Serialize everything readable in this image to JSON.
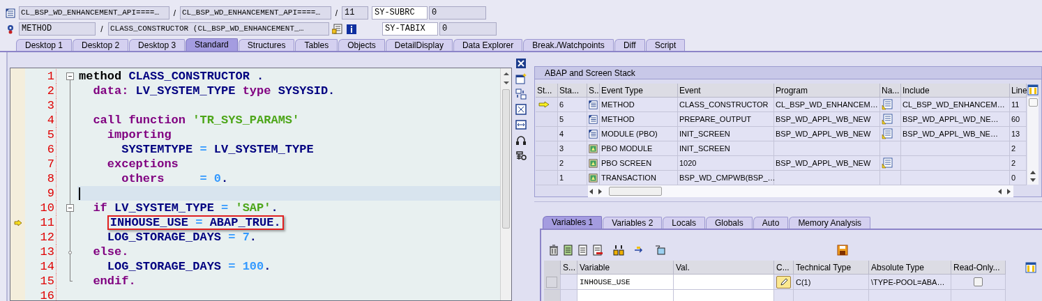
{
  "header": {
    "row_1": {
      "class_field": "CL_BSP_WD_ENHANCEMENT_API====…",
      "separator_1": "/",
      "include_field": "CL_BSP_WD_ENHANCEMENT_API====…",
      "separator_2": "/",
      "line_field": "11",
      "sysvar_label": "SY-SUBRC",
      "sysvar_value": "0"
    },
    "row_2": {
      "type_field": "METHOD",
      "separator": "/",
      "event_field": "CLASS_CONSTRUCTOR (CL_BSP_WD_ENHANCEMENT_…",
      "sysvar_label": "SY-TABIX",
      "sysvar_value": "0"
    }
  },
  "tabs": [
    {
      "label": "Desktop 1",
      "selected": false
    },
    {
      "label": "Desktop 2",
      "selected": false
    },
    {
      "label": "Desktop 3",
      "selected": false
    },
    {
      "label": "Standard",
      "selected": true
    },
    {
      "label": "Structures",
      "selected": false
    },
    {
      "label": "Tables",
      "selected": false
    },
    {
      "label": "Objects",
      "selected": false
    },
    {
      "label": "DetailDisplay",
      "selected": false
    },
    {
      "label": "Data Explorer",
      "selected": false
    },
    {
      "label": "Break./Watchpoints",
      "selected": false
    },
    {
      "label": "Diff",
      "selected": false
    },
    {
      "label": "Script",
      "selected": false
    }
  ],
  "editor": {
    "lines": [
      {
        "number": "1",
        "fold_start": true,
        "segments": [
          {
            "kind": "statement",
            "text": "method"
          },
          {
            "kind": "identifier",
            "text": " CLASS_CONSTRUCTOR ."
          }
        ]
      },
      {
        "number": "2",
        "segments": [
          {
            "kind": "keyword",
            "text": "  data:"
          },
          {
            "kind": "identifier",
            "text": " LV_SYSTEM_TYPE "
          },
          {
            "kind": "keyword",
            "text": "type"
          },
          {
            "kind": "identifier",
            "text": " SYSYSID."
          }
        ]
      },
      {
        "number": "3"
      },
      {
        "number": "4",
        "segments": [
          {
            "kind": "keyword",
            "text": "  call function"
          },
          {
            "kind": "string",
            "text": " 'TR_SYS_PARAMS'"
          }
        ]
      },
      {
        "number": "5",
        "segments": [
          {
            "kind": "keyword",
            "text": "    importing"
          }
        ]
      },
      {
        "number": "6",
        "segments": [
          {
            "kind": "identifier",
            "text": "      SYSTEMTYPE"
          },
          {
            "kind": "operator",
            "text": " = "
          },
          {
            "kind": "identifier",
            "text": "LV_SYSTEM_TYPE"
          }
        ]
      },
      {
        "number": "7",
        "segments": [
          {
            "kind": "keyword",
            "text": "    exceptions"
          }
        ]
      },
      {
        "number": "8",
        "segments": [
          {
            "kind": "keyword",
            "text": "      others"
          },
          {
            "kind": "operator",
            "text": "     = "
          },
          {
            "kind": "number",
            "text": "0"
          },
          {
            "kind": "identifier",
            "text": "."
          }
        ]
      },
      {
        "number": "9",
        "cursor": true
      },
      {
        "number": "10",
        "fold_start": true,
        "segments": [
          {
            "kind": "keyword",
            "text": "  if"
          },
          {
            "kind": "identifier",
            "text": " LV_SYSTEM_TYPE "
          },
          {
            "kind": "operator",
            "text": "= "
          },
          {
            "kind": "string",
            "text": "'SAP'"
          },
          {
            "kind": "identifier",
            "text": "."
          }
        ]
      },
      {
        "number": "11",
        "execution_point": true,
        "boxed": true,
        "segments": [
          {
            "kind": "identifier",
            "text": "    INHOUSE_USE"
          },
          {
            "kind": "operator",
            "text": " = "
          },
          {
            "kind": "identifier",
            "text": "ABAP_TRUE."
          }
        ]
      },
      {
        "number": "12",
        "segments": [
          {
            "kind": "identifier",
            "text": "    LOG_STORAGE_DAYS"
          },
          {
            "kind": "operator",
            "text": " = "
          },
          {
            "kind": "number",
            "text": "7"
          },
          {
            "kind": "identifier",
            "text": "."
          }
        ]
      },
      {
        "number": "13",
        "fold_branch": true,
        "segments": [
          {
            "kind": "keyword",
            "text": "  else."
          }
        ]
      },
      {
        "number": "14",
        "segments": [
          {
            "kind": "identifier",
            "text": "    LOG_STORAGE_DAYS"
          },
          {
            "kind": "operator",
            "text": " = "
          },
          {
            "kind": "number",
            "text": "100"
          },
          {
            "kind": "identifier",
            "text": "."
          }
        ]
      },
      {
        "number": "15",
        "fold_end": true,
        "segments": [
          {
            "kind": "keyword",
            "text": "  endif."
          }
        ]
      },
      {
        "number": "16"
      }
    ]
  },
  "stack": {
    "title": "ABAP and Screen Stack",
    "columns": [
      "St...",
      "Sta...",
      "S..",
      "Event Type",
      "Event",
      "Program",
      "Na...",
      "Include",
      "Line"
    ],
    "rows": [
      {
        "current": true,
        "stack_no": "6",
        "kind": "method",
        "event_type": "METHOD",
        "event": "CLASS_CONSTRUCTOR",
        "program": "CL_BSP_WD_ENHANCEM…",
        "navigable": true,
        "include": "CL_BSP_WD_ENHANCEM…",
        "line": "11"
      },
      {
        "current": false,
        "stack_no": "5",
        "kind": "method",
        "event_type": "METHOD",
        "event": "PREPARE_OUTPUT",
        "program": "BSP_WD_APPL_WB_NEW",
        "navigable": true,
        "include": "BSP_WD_APPL_WD_NE…",
        "line": "60"
      },
      {
        "current": false,
        "stack_no": "4",
        "kind": "method",
        "event_type": "MODULE (PBO)",
        "event": "INIT_SCREEN",
        "program": "BSP_WD_APPL_WB_NEW",
        "navigable": true,
        "include": "BSP_WD_APPL_WB_NE…",
        "line": "13"
      },
      {
        "current": false,
        "stack_no": "3",
        "kind": "screen",
        "event_type": "PBO MODULE",
        "event": "INIT_SCREEN",
        "navigable": false,
        "line": "2"
      },
      {
        "current": false,
        "stack_no": "2",
        "kind": "screen",
        "event_type": "PBO SCREEN",
        "event": "1020",
        "program": "BSP_WD_APPL_WB_NEW",
        "navigable": true,
        "line": "2"
      },
      {
        "current": false,
        "stack_no": "1",
        "kind": "screen",
        "event_type": "TRANSACTION",
        "event": "BSP_WD_CMPWB(BSP_…",
        "navigable": false,
        "line": "0"
      }
    ]
  },
  "variables": {
    "tabs": [
      {
        "label": "Variables 1",
        "selected": true
      },
      {
        "label": "Variables 2",
        "selected": false
      },
      {
        "label": "Locals",
        "selected": false
      },
      {
        "label": "Globals",
        "selected": false
      },
      {
        "label": "Auto",
        "selected": false
      },
      {
        "label": "Memory Analysis",
        "selected": false
      }
    ],
    "columns": [
      "S...",
      "Variable",
      "Val.",
      "C...",
      "Technical Type",
      "Absolute Type",
      "Read-Only..."
    ],
    "rows": [
      {
        "variable": "INHOUSE_USE",
        "editable": true,
        "technical_type": "C(1)",
        "absolute_type": "\\TYPE-POOL=ABA…",
        "read_only": false
      }
    ]
  }
}
